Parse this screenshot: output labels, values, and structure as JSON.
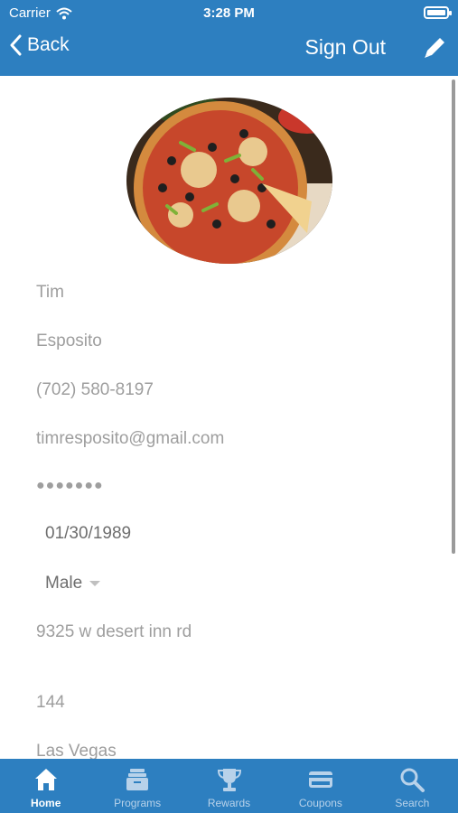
{
  "status_bar": {
    "carrier": "Carrier",
    "time": "3:28 PM"
  },
  "nav": {
    "back_label": "Back",
    "signout_label": "Sign Out"
  },
  "profile": {
    "first_name": "Tim",
    "last_name": "Esposito",
    "phone": "(702) 580-8197",
    "email": "timresposito@gmail.com",
    "password_mask": "●●●●●●●",
    "birthdate": "01/30/1989",
    "gender": "Male",
    "address": "9325 w desert inn rd",
    "address2": "144",
    "city": "Las Vegas"
  },
  "tabs": [
    {
      "label": "Home",
      "icon": "home-icon"
    },
    {
      "label": "Programs",
      "icon": "programs-icon"
    },
    {
      "label": "Rewards",
      "icon": "trophy-icon"
    },
    {
      "label": "Coupons",
      "icon": "coupon-icon"
    },
    {
      "label": "Search",
      "icon": "search-icon"
    }
  ],
  "colors": {
    "brand": "#2d7fc0",
    "field_text": "#9e9e9e",
    "tab_inactive": "#b8d2ea"
  }
}
